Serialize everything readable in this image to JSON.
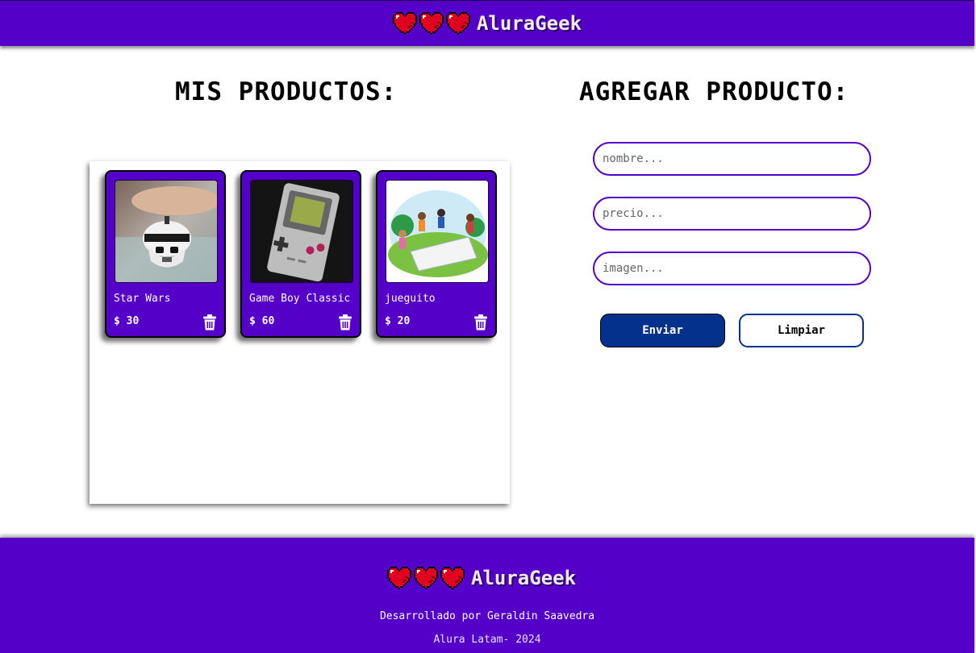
{
  "header": {
    "brand": "AluraGeek"
  },
  "products_section": {
    "title": "MIS PRODUCTOS:"
  },
  "products": [
    {
      "name": "Star Wars",
      "price": "$ 30"
    },
    {
      "name": "Game Boy Classic",
      "price": "$ 60"
    },
    {
      "name": "jueguito",
      "price": "$ 20"
    }
  ],
  "form": {
    "title": "AGREGAR PRODUCTO:",
    "name_placeholder": "nombre...",
    "price_placeholder": "precio...",
    "image_placeholder": "imagen...",
    "submit_label": "Enviar",
    "clear_label": "Limpiar"
  },
  "footer": {
    "brand": "AluraGeek",
    "credit": "Desarrollado por Geraldin Saavedra",
    "copyright": "Alura Latam- 2024"
  },
  "colors": {
    "primary": "#5500c8",
    "button_blue": "#03318c",
    "heart_red": "#e0001f"
  }
}
